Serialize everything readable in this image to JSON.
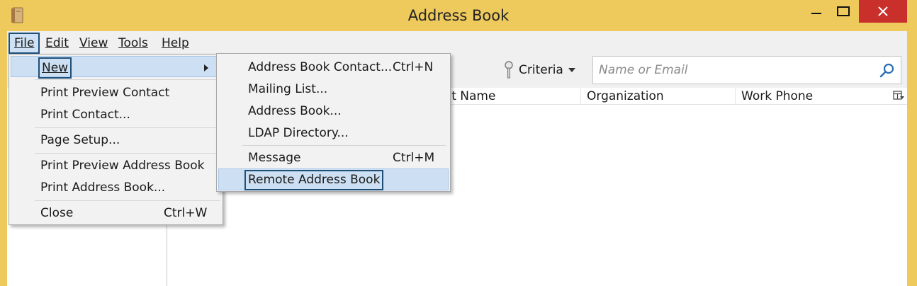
{
  "window": {
    "title": "Address Book",
    "close_color": "#c9302c",
    "frame_color": "#eec95c"
  },
  "menubar": {
    "file": "File",
    "edit": "Edit",
    "view": "View",
    "tools": "Tools",
    "help": "Help"
  },
  "toolbar": {
    "criteria_label": "Criteria",
    "search_placeholder": "Name or Email"
  },
  "list": {
    "columns": [
      "hat Name",
      "Organization",
      "Work Phone"
    ]
  },
  "file_menu": {
    "items": [
      {
        "label": "New",
        "has_submenu": true,
        "highlighted": true
      },
      {
        "label": "Print Preview Contact"
      },
      {
        "label": "Print Contact..."
      },
      {
        "label": "Page Setup..."
      },
      {
        "label": "Print Preview Address Book"
      },
      {
        "label": "Print Address Book..."
      },
      {
        "label": "Close",
        "shortcut": "Ctrl+W"
      }
    ]
  },
  "new_menu": {
    "items": [
      {
        "label": "Address Book Contact...",
        "shortcut": "Ctrl+N"
      },
      {
        "label": "Mailing List..."
      },
      {
        "label": "Address Book..."
      },
      {
        "label": "LDAP Directory..."
      },
      {
        "label": "Message",
        "shortcut": "Ctrl+M"
      },
      {
        "label": "Remote Address Book",
        "highlighted": true
      }
    ]
  },
  "icons": {
    "app": "address-book-icon",
    "criteria": "key-icon",
    "search": "search-icon",
    "column_picker": "column-picker-icon",
    "minimize": "minimize-icon",
    "maximize": "maximize-icon",
    "close": "close-icon"
  }
}
